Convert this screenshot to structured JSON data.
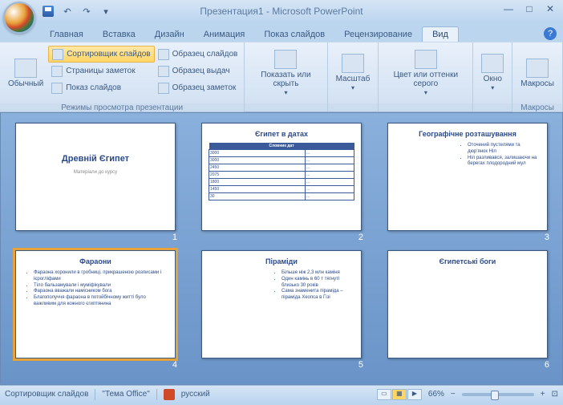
{
  "title": "Презентация1 - Microsoft PowerPoint",
  "qat": {
    "undo": "↶",
    "redo": "↷",
    "more": "▾"
  },
  "wc": {
    "min": "—",
    "max": "□",
    "close": "✕"
  },
  "help": "?",
  "tabs": {
    "t1": "Главная",
    "t2": "Вставка",
    "t3": "Дизайн",
    "t4": "Анимация",
    "t5": "Показ слайдов",
    "t6": "Рецензирование",
    "t7": "Вид"
  },
  "ribbon": {
    "g1": {
      "normal": "Обычный",
      "sorter": "Сортировщик слайдов",
      "notes": "Страницы заметок",
      "show": "Показ слайдов",
      "label": "Режимы просмотра презентации",
      "master1": "Образец слайдов",
      "master2": "Образец выдач",
      "master3": "Образец заметок"
    },
    "g2": {
      "showhide": "Показать или скрыть"
    },
    "g3": {
      "zoom": "Масштаб"
    },
    "g4": {
      "color": "Цвет или оттенки серого"
    },
    "g5": {
      "window": "Окно"
    },
    "g6": {
      "macros": "Макросы",
      "label": "Макросы"
    }
  },
  "slides": {
    "s1": {
      "title": "Древній Єгипет",
      "sub": "Матеріали до курсу"
    },
    "s2": {
      "title": "Єгипет в датах",
      "th": "Словник дат"
    },
    "s3": {
      "title": "Географічне розташування",
      "b1": "Оточений пустелями та дюр'янок Ніл",
      "b2": "Ніл разливався, залишаючи на берегах плодородний мул"
    },
    "s4": {
      "title": "Фараони",
      "b1": "Фараона хоронили в гробниці, прикрашеною розписами і ієрогліфами",
      "b2": "Тіло бальзамували і муміфікували",
      "b3": "Фараона вважали намісником бога",
      "b4": "Благополуччя фараона в потойбічному житті було важливим для кожного єгиптянина"
    },
    "s5": {
      "title": "Піраміди",
      "b1": "Більше ніж 2,3 млн каміня",
      "b2": "Один камінь в 60 т тягнуті близько 30 років",
      "b3": "Сама знаменита піраміда – піраміда Хеопса в Гізі"
    },
    "s6": {
      "title": "Єгипетські боги"
    }
  },
  "status": {
    "view": "Сортировщик слайдов",
    "theme": "\"Тема Office\"",
    "lang": "русский",
    "zoom": "66%",
    "minus": "−",
    "plus": "+",
    "fit": "⊡"
  }
}
